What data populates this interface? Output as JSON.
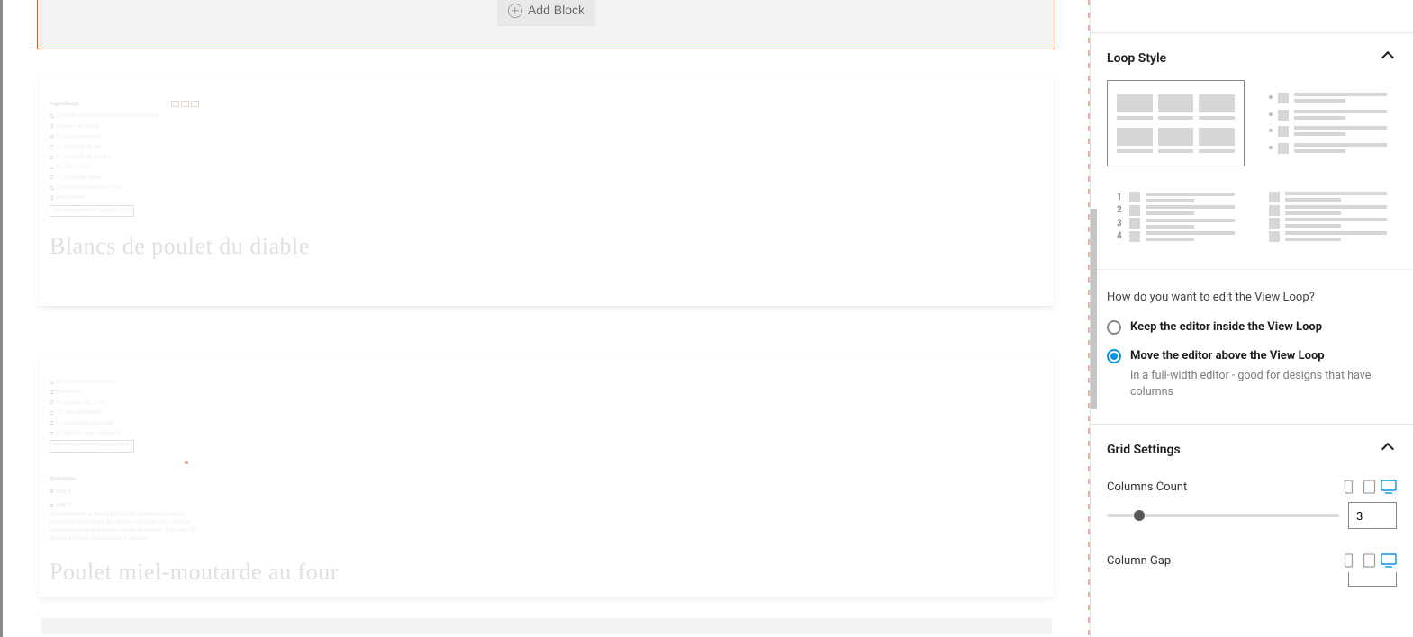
{
  "editor": {
    "add_block_label": "Add Block"
  },
  "cards": [
    {
      "title": "Blancs de poulet du diable",
      "section_heading": "Ingredients",
      "ingredients": [
        "2 cuil d'huile d'olive ou de coco extra vierge",
        "4 blancs de poulet",
        "1 gousse moyenne",
        "1 cuil à café de thé",
        "1 cuil à café de romarin",
        "1 pincée de sel",
        "1 cuil cuil de citron",
        "2 cuil de moutarde de Dijon",
        "sel et poivre"
      ],
      "add_btn": "Add an ingredient or Shopping List ID"
    },
    {
      "title": "Poulet miel-moutarde au four",
      "ingredients": [
        "Sel herbes miel moutarde",
        "Poivre noir",
        "1 concassé de citron",
        "1 pincée de fenouil",
        "2 cuil à soupe moutarde",
        "8 hauts de cuisse de poulet"
      ],
      "add_btn": "Add an ingredient or Shopping List ID",
      "directions_heading": "Directions",
      "steps": [
        {
          "label": "Step 1",
          "body": ""
        },
        {
          "label": "Step 2",
          "body": "Set manometer le temps à four puis laisser mijoter sel et poivre puis une cuillère afin de bien mélanger puis recouvrir hermétiquement et avec les miettes de cuisson. Cuire env 35-40 min. En fin de cuisson saler à nouveau."
        }
      ]
    }
  ],
  "sidebar": {
    "loop_style": {
      "title": "Loop Style",
      "options": {
        "grid": "grid",
        "bullets": "bullets",
        "numbered": "numbered",
        "plain": "plain"
      },
      "numbers": [
        "1",
        "2",
        "3",
        "4"
      ],
      "question": "How do you want to edit the View Loop?",
      "radios": [
        {
          "label": "Keep the editor inside the View Loop",
          "desc": ""
        },
        {
          "label": "Move the editor above the View Loop",
          "desc": "In a full-width editor - good for designs that have columns"
        }
      ]
    },
    "grid_settings": {
      "title": "Grid Settings",
      "columns_label": "Columns Count",
      "columns_value": "3",
      "gap_label": "Column Gap"
    }
  }
}
